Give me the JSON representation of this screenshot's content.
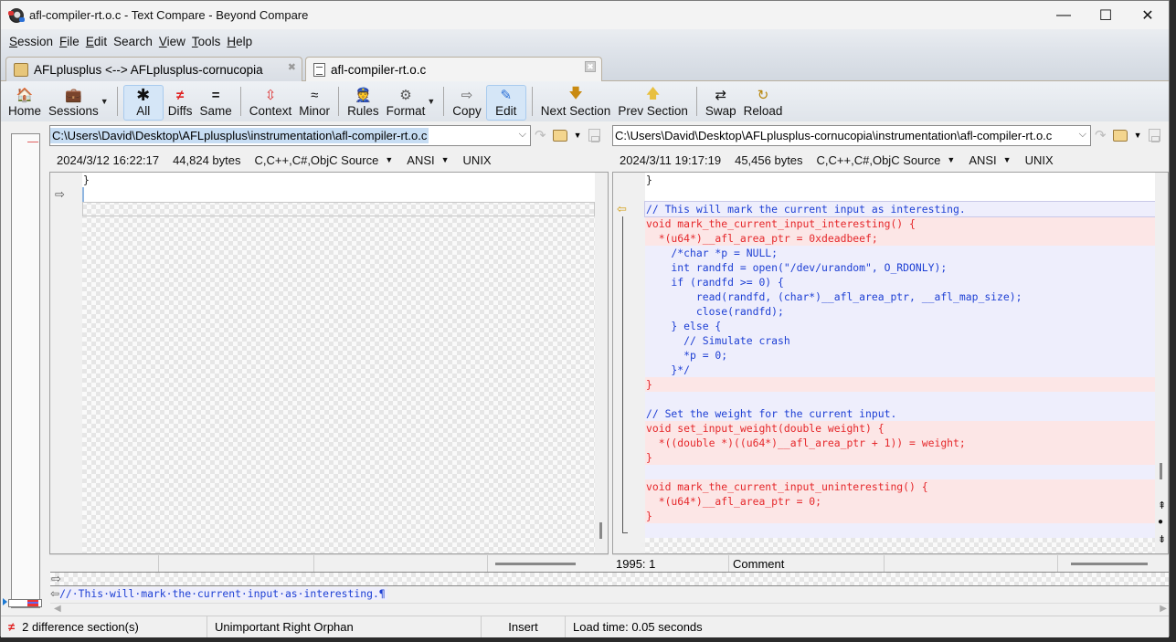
{
  "window": {
    "title": "afl-compiler-rt.o.c - Text Compare - Beyond Compare",
    "controls": {
      "minimize": "—",
      "maximize": "☐",
      "close": "✕"
    }
  },
  "menu": [
    {
      "label": "Session",
      "mnemonic": "S",
      "rest": "ession"
    },
    {
      "label": "File",
      "mnemonic": "F",
      "rest": "ile"
    },
    {
      "label": "Edit",
      "mnemonic": "E",
      "rest": "dit"
    },
    {
      "label": "Search",
      "mnemonic": "",
      "rest": "Search"
    },
    {
      "label": "View",
      "mnemonic": "V",
      "rest": "iew"
    },
    {
      "label": "Tools",
      "mnemonic": "T",
      "rest": "ools"
    },
    {
      "label": "Help",
      "mnemonic": "H",
      "rest": "elp"
    }
  ],
  "tabs": [
    {
      "label": "AFLplusplus <--> AFLplusplus-cornucopia",
      "icon": "folder-compare-icon",
      "active": false,
      "close": "✖"
    },
    {
      "label": "afl-compiler-rt.o.c",
      "icon": "text-compare-icon",
      "active": true,
      "close": "✖"
    }
  ],
  "toolbar": {
    "home": {
      "label": "Home",
      "icon": "🏠"
    },
    "sessions": {
      "label": "Sessions",
      "icon": "💼"
    },
    "all": {
      "label": "All",
      "icon": "✱"
    },
    "diffs": {
      "label": "Diffs",
      "icon": "≠"
    },
    "same": {
      "label": "Same",
      "icon": "="
    },
    "context": {
      "label": "Context",
      "icon": "⇳"
    },
    "minor": {
      "label": "Minor",
      "icon": "≈"
    },
    "rules": {
      "label": "Rules",
      "icon": "👮"
    },
    "format": {
      "label": "Format",
      "icon": "⚙"
    },
    "copy": {
      "label": "Copy",
      "icon": "⇨"
    },
    "edit": {
      "label": "Edit",
      "icon": "✎"
    },
    "next_section": {
      "label": "Next Section",
      "icon": "🡇"
    },
    "prev_section": {
      "label": "Prev Section",
      "icon": "🡅"
    },
    "swap": {
      "label": "Swap",
      "icon": "⇄"
    },
    "reload": {
      "label": "Reload",
      "icon": "↻"
    },
    "dropdown": "▼"
  },
  "left": {
    "path": "C:\\Users\\David\\Desktop\\AFLplusplus\\instrumentation\\afl-compiler-rt.o.c",
    "timestamp": "2024/3/12 16:22:17",
    "size": "44,824 bytes",
    "format": "C,C++,C#,ObjC Source",
    "encoding": "ANSI",
    "line_endings": "UNIX",
    "lines": [
      {
        "text": "}",
        "kind": "same"
      },
      {
        "text": "",
        "kind": "same",
        "cursor": true
      }
    ],
    "status": {
      "position": "",
      "type": "",
      "extra": ""
    }
  },
  "right": {
    "path": "C:\\Users\\David\\Desktop\\AFLplusplus-cornucopia\\instrumentation\\afl-compiler-rt.o.c",
    "timestamp": "2024/3/11 19:17:19",
    "size": "45,456 bytes",
    "format": "C,C++,C#,ObjC Source",
    "encoding": "ANSI",
    "line_endings": "UNIX",
    "lines": [
      {
        "text": "}",
        "kind": "same"
      },
      {
        "text": "",
        "kind": "same"
      },
      {
        "text": "// This will mark the current input as interesting.",
        "kind": "orph-c"
      },
      {
        "text": "void mark_the_current_input_interesting() {",
        "kind": "orph"
      },
      {
        "text": "  *(u64*)__afl_area_ptr = 0xdeadbeef;",
        "kind": "orph"
      },
      {
        "text": "    /*char *p = NULL;",
        "kind": "orph-b"
      },
      {
        "text": "    int randfd = open(\"/dev/urandom\", O_RDONLY);",
        "kind": "orph-b"
      },
      {
        "text": "    if (randfd >= 0) {",
        "kind": "orph-b"
      },
      {
        "text": "        read(randfd, (char*)__afl_area_ptr, __afl_map_size);",
        "kind": "orph-b"
      },
      {
        "text": "        close(randfd);",
        "kind": "orph-b"
      },
      {
        "text": "    } else {",
        "kind": "orph-b"
      },
      {
        "text": "      // Simulate crash",
        "kind": "orph-b"
      },
      {
        "text": "      *p = 0;",
        "kind": "orph-b"
      },
      {
        "text": "    }*/",
        "kind": "orph-b"
      },
      {
        "text": "}",
        "kind": "orph"
      },
      {
        "text": "",
        "kind": "blank-b"
      },
      {
        "text": "// Set the weight for the current input.",
        "kind": "orph-c"
      },
      {
        "text": "void set_input_weight(double weight) {",
        "kind": "orph"
      },
      {
        "text": "  *((double *)((u64*)__afl_area_ptr + 1)) = weight;",
        "kind": "orph"
      },
      {
        "text": "}",
        "kind": "orph"
      },
      {
        "text": "",
        "kind": "blank-b"
      },
      {
        "text": "void mark_the_current_input_uninteresting() {",
        "kind": "orph"
      },
      {
        "text": "  *(u64*)__afl_area_ptr = 0;",
        "kind": "orph"
      },
      {
        "text": "}",
        "kind": "orph"
      },
      {
        "text": "",
        "kind": "blank-b"
      }
    ],
    "status": {
      "position": "1995: 1",
      "type": "Comment",
      "extra": ""
    }
  },
  "merge": {
    "line": "//·This·will·mark·the·current·input·as·interesting.¶"
  },
  "statusbar": {
    "diff_icon": "≠",
    "differences": "2 difference section(s)",
    "kind": "Unimportant Right Orphan",
    "mode": "Insert",
    "load_time": "Load time: 0.05 seconds"
  },
  "colors": {
    "orphan_text": "#e5282b",
    "orphan_bg": "#fce6e6",
    "comment_text": "#1d3fd4",
    "comment_bg": "#eeeefc",
    "selection": "#c7ddf3"
  }
}
